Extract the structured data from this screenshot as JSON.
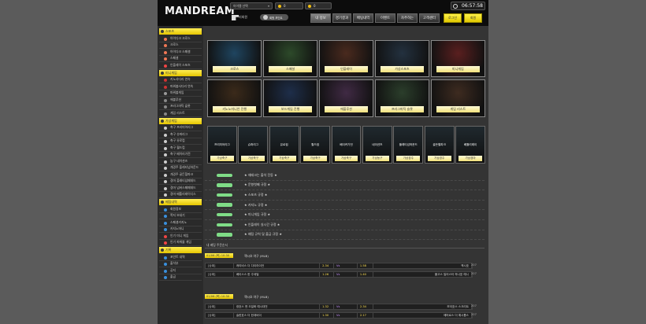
{
  "header": {
    "logo": "MANDREAM",
    "select": "아이템 선택",
    "select_short": "회원 포인트",
    "balance": "0",
    "points": "0",
    "level_label": "미회원",
    "time": "06:57:58",
    "nav": [
      "내 정보",
      "경기결과",
      "배팅내역",
      "이벤트",
      "자주하는",
      "고객센터"
    ],
    "yellow": [
      "로그인",
      "회원"
    ]
  },
  "sidebar": {
    "sections": [
      {
        "title": "스포츠",
        "items": [
          {
            "label": "아이다크 크로스",
            "color": "#e75"
          },
          {
            "label": "크로스",
            "color": "#e75"
          },
          {
            "label": "아이다크 스페셜",
            "color": "#e75"
          },
          {
            "label": "스페셜",
            "color": "#e75"
          },
          {
            "label": "인플레이 스포츠",
            "color": "#e44"
          }
        ]
      },
      {
        "title": "미니게임",
        "items": [
          {
            "label": "키노사다리 연속",
            "color": "#c33"
          },
          {
            "label": "파워볼사다리 연속",
            "color": "#c33"
          },
          {
            "label": "파워볼게임",
            "color": "#999"
          },
          {
            "label": "에볼루션",
            "color": "#888"
          },
          {
            "label": "프라그마틱 슬롯",
            "color": "#888"
          },
          {
            "label": "게임 리스트",
            "color": "#888"
          }
        ]
      },
      {
        "title": "가상게임",
        "items": [
          {
            "label": "축구 프리미어리그",
            "color": "#ccc"
          },
          {
            "label": "축구 슈퍼리그",
            "color": "#ccc"
          },
          {
            "label": "축구 유로컵",
            "color": "#ccc"
          },
          {
            "label": "축구 월드컵",
            "color": "#ccc"
          },
          {
            "label": "축구 베이러가전",
            "color": "#ccc"
          },
          {
            "label": "농구 네이션즈",
            "color": "#ccc"
          },
          {
            "label": "개경주 플래티넘하운드",
            "color": "#ccc"
          },
          {
            "label": "개경주 골든힐파크",
            "color": "#ccc"
          },
          {
            "label": "경마 플래티넘페데드",
            "color": "#ccc"
          },
          {
            "label": "경마 넘버스페페데드",
            "color": "#ccc"
          },
          {
            "label": "경마 베틀리레이디스",
            "color": "#ccc"
          }
        ]
      },
      {
        "title": "베팅내역",
        "items": [
          {
            "label": "회원정보",
            "color": "#3a8fdc"
          },
          {
            "label": "쪽지 보내기",
            "color": "#3a8fdc"
          },
          {
            "label": "스페셜카지노",
            "color": "#3a8fdc"
          },
          {
            "label": "카지노머니",
            "color": "#3a8fdc"
          },
          {
            "label": "인기 미니 게임",
            "color": "#e44"
          },
          {
            "label": "인기 파워볼 게임",
            "color": "#e44"
          }
        ]
      },
      {
        "title": "기록",
        "items": [
          {
            "label": "포인트 내역",
            "color": "#3a8fdc"
          },
          {
            "label": "출석부",
            "color": "#3a8fdc"
          },
          {
            "label": "공지",
            "color": "#3a8fdc"
          },
          {
            "label": "출금",
            "color": "#3a8fdc"
          }
        ]
      }
    ]
  },
  "tiles_row1": [
    "크로스",
    "스페셜",
    "인플레이",
    "가상스포츠",
    "미니게임"
  ],
  "tiles_row2": [
    "키노노미니안 진행",
    "보드게임 진행",
    "에볼루션",
    "프라그마틱 슬롯",
    "게임 리스트"
  ],
  "small_tiles": [
    {
      "name": "프리미어리그",
      "label": "가상축구"
    },
    {
      "name": "슈퍼리그",
      "label": "가상축구"
    },
    {
      "name": "유로컵",
      "label": "가상축구"
    },
    {
      "name": "월드컵",
      "label": "가상축구"
    },
    {
      "name": "베이커가전",
      "label": "가상축구"
    },
    {
      "name": "네이션즈",
      "label": "가상농구"
    },
    {
      "name": "플래티넘하운드",
      "label": "가상경주"
    },
    {
      "name": "골든힐파크",
      "label": "가상경주"
    },
    {
      "name": "베틀리레이",
      "label": "가상경마"
    }
  ],
  "announcements": [
    "★ 재테크는 출석 진동 ★",
    "★ 문향첫째 규정 ★",
    "★ 스포츠 규정 ★",
    "★ 카지노 규정 ★",
    "★ 미니게임 규정 ★",
    "★ 인플레이 실시간 규정 ★",
    "★ 배팅 규칙 및 출금 규정 ★"
  ],
  "recent_header": "내 베팅 주문순서",
  "groups": [
    {
      "date": "01/06 (목) 10:30",
      "title": "잭시호 야구 (MLB)",
      "rows": [
        {
          "time": "[승패]",
          "home": "캐리비스 더 다이라이언",
          "hv": "2.34",
          "mid": "Vs",
          "av": "1.58",
          "away": "잭시호",
          "tail": "207"
        },
        {
          "time": "[승패]",
          "home": "베이스스 한 주세빌",
          "hv": "1.26",
          "mid": "Vs",
          "av": "1.40",
          "away": "플고스 일어스터 하나호 예시",
          "tail": "207"
        }
      ]
    },
    {
      "date": "01/06 (목) 10:30",
      "title": "잭시호 야구 (MLB)",
      "rows": [
        {
          "time": "[승패]",
          "home": "광호스 앤 오일화 예시대전",
          "hv": "1.32",
          "mid": "Vs",
          "av": "2.34",
          "away": "보이호스 스크리트",
          "tail": "207"
        },
        {
          "time": "[승패]",
          "home": "슬한호스 더 한계비이",
          "hv": "1.30",
          "mid": "Vs",
          "av": "2.17",
          "away": "에머로스 더 예시롭스",
          "tail": "207"
        }
      ]
    }
  ]
}
